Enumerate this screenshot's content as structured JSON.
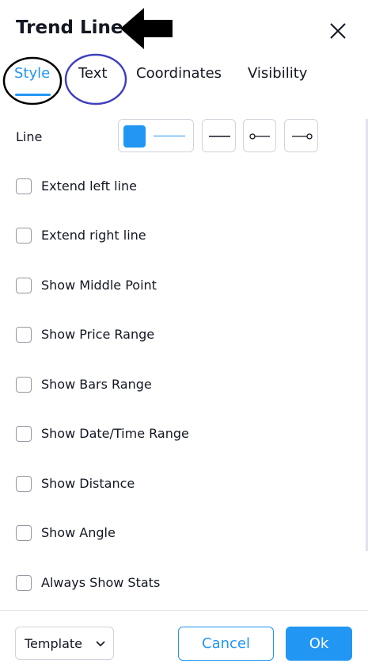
{
  "dialog": {
    "title": "Trend Line",
    "close_icon": "close-icon",
    "accent_color": "#2196f3"
  },
  "tabs": [
    {
      "label": "Style",
      "active": true
    },
    {
      "label": "Text",
      "active": false
    },
    {
      "label": "Coordinates",
      "active": false
    },
    {
      "label": "Visibility",
      "active": false
    }
  ],
  "line_row": {
    "label": "Line",
    "line_color": "#2196f3",
    "style_icons": [
      "line-width-icon",
      "line-style-solid-icon",
      "left-end-circle-icon",
      "right-end-circle-icon"
    ]
  },
  "options": [
    {
      "label": "Extend left line",
      "checked": false
    },
    {
      "label": "Extend right line",
      "checked": false
    },
    {
      "label": "Show Middle Point",
      "checked": false
    },
    {
      "label": "Show Price Range",
      "checked": false
    },
    {
      "label": "Show Bars Range",
      "checked": false
    },
    {
      "label": "Show Date/Time Range",
      "checked": false
    },
    {
      "label": "Show Distance",
      "checked": false
    },
    {
      "label": "Show Angle",
      "checked": false
    },
    {
      "label": "Always Show Stats",
      "checked": false
    }
  ],
  "footer": {
    "template_label": "Template",
    "cancel_label": "Cancel",
    "ok_label": "Ok"
  }
}
